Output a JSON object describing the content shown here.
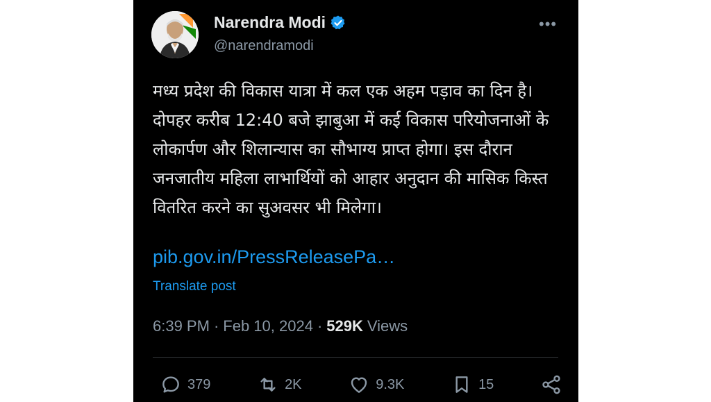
{
  "author": {
    "name": "Narendra Modi",
    "handle": "@narendramodi",
    "verified_icon": "verified-badge-icon"
  },
  "post": {
    "text": "मध्य प्रदेश की विकास यात्रा में कल एक अहम पड़ाव का दिन है। दोपहर करीब 12:40 बजे झाबुआ में कई विकास परियोजनाओं के लोकार्पण और शिलान्यास का सौभाग्य प्राप्त होगा। इस दौरान जनजातीय महिला लाभार्थियों को आहार अनुदान की मासिक किस्त वितरित करने का सुअवसर भी मिलेगा।",
    "link": "pib.gov.in/PressReleasePa…",
    "translate_label": "Translate post"
  },
  "meta": {
    "time": "6:39 PM",
    "sep1": "·",
    "date": "Feb 10, 2024",
    "sep2": "·",
    "views_count": "529K",
    "views_label": "Views"
  },
  "actions": {
    "replies": "379",
    "reposts": "2K",
    "likes": "9.3K",
    "bookmarks": "15"
  },
  "colors": {
    "background": "#000000",
    "text": "#e7e9ea",
    "secondary": "#8b98a5",
    "link": "#1d9bf0"
  }
}
